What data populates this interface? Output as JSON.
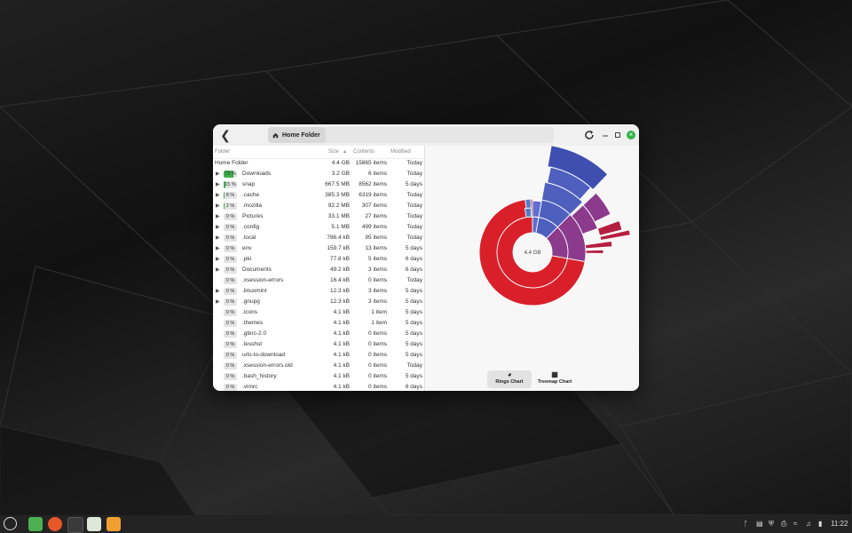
{
  "window": {
    "breadcrumb": "Home Folder",
    "back_icon": "arrow-left-icon",
    "reload_icon": "refresh-icon",
    "minimize_icon": "minimize-icon",
    "maximize_icon": "maximize-icon",
    "close_icon": "close-icon"
  },
  "table": {
    "headers": {
      "folder": "Folder",
      "size": "Size",
      "contents": "Contents",
      "modified": "Modified"
    },
    "root": {
      "name": "Home Folder",
      "size": "4.4 GB",
      "items": "15865 items",
      "modified": "Today"
    },
    "rows": [
      {
        "pct": "73 %",
        "fill": 0.73,
        "name": "Downloads",
        "size": "3.2 GB",
        "items": "6 items",
        "modified": "Today",
        "expandable": true
      },
      {
        "pct": "15 %",
        "fill": 0.15,
        "name": "snap",
        "size": "667.5 MB",
        "items": "8562 items",
        "modified": "5 days",
        "expandable": true
      },
      {
        "pct": "8 %",
        "fill": 0.08,
        "name": ".cache",
        "size": "385.3 MB",
        "items": "6319 items",
        "modified": "Today",
        "expandable": true
      },
      {
        "pct": "2 %",
        "fill": 0.02,
        "name": ".mozilla",
        "size": "92.2 MB",
        "items": "307 items",
        "modified": "Today",
        "expandable": true
      },
      {
        "pct": "0 %",
        "fill": 0,
        "name": "Pictures",
        "size": "33.1 MB",
        "items": "27 items",
        "modified": "Today",
        "expandable": true
      },
      {
        "pct": "0 %",
        "fill": 0,
        "name": ".config",
        "size": "5.1 MB",
        "items": "499 items",
        "modified": "Today",
        "expandable": true
      },
      {
        "pct": "0 %",
        "fill": 0,
        "name": ".local",
        "size": "786.4 kB",
        "items": "95 items",
        "modified": "Today",
        "expandable": true
      },
      {
        "pct": "0 %",
        "fill": 0,
        "name": "env",
        "size": "159.7 kB",
        "items": "13 items",
        "modified": "5 days",
        "expandable": true
      },
      {
        "pct": "0 %",
        "fill": 0,
        "name": ".pki",
        "size": "77.8 kB",
        "items": "5 items",
        "modified": "6 days",
        "expandable": true
      },
      {
        "pct": "0 %",
        "fill": 0,
        "name": "Documents",
        "size": "49.2 kB",
        "items": "3 items",
        "modified": "6 days",
        "expandable": true
      },
      {
        "pct": "0 %",
        "fill": 0,
        "name": ".xsession-errors",
        "size": "16.4 kB",
        "items": "0 items",
        "modified": "Today",
        "expandable": false
      },
      {
        "pct": "0 %",
        "fill": 0,
        "name": ".linuxmint",
        "size": "12.3 kB",
        "items": "3 items",
        "modified": "5 days",
        "expandable": true
      },
      {
        "pct": "0 %",
        "fill": 0,
        "name": ".gnupg",
        "size": "12.3 kB",
        "items": "3 items",
        "modified": "5 days",
        "expandable": true
      },
      {
        "pct": "0 %",
        "fill": 0,
        "name": ".icons",
        "size": "4.1 kB",
        "items": "1 item",
        "modified": "5 days",
        "expandable": false
      },
      {
        "pct": "0 %",
        "fill": 0,
        "name": ".themes",
        "size": "4.1 kB",
        "items": "1 item",
        "modified": "5 days",
        "expandable": false
      },
      {
        "pct": "0 %",
        "fill": 0,
        "name": ".gtkrc-2.0",
        "size": "4.1 kB",
        "items": "0 items",
        "modified": "5 days",
        "expandable": false
      },
      {
        "pct": "0 %",
        "fill": 0,
        "name": ".lesshst",
        "size": "4.1 kB",
        "items": "0 items",
        "modified": "5 days",
        "expandable": false
      },
      {
        "pct": "0 %",
        "fill": 0,
        "name": "urls-to-download",
        "size": "4.1 kB",
        "items": "0 items",
        "modified": "5 days",
        "expandable": false
      },
      {
        "pct": "0 %",
        "fill": 0,
        "name": ".xsession-errors.old",
        "size": "4.1 kB",
        "items": "0 items",
        "modified": "Today",
        "expandable": false
      },
      {
        "pct": "0 %",
        "fill": 0,
        "name": ".bash_history",
        "size": "4.1 kB",
        "items": "0 items",
        "modified": "5 days",
        "expandable": false
      },
      {
        "pct": "0 %",
        "fill": 0,
        "name": ".vimrc",
        "size": "4.1 kB",
        "items": "0 items",
        "modified": "6 days",
        "expandable": false
      }
    ]
  },
  "rings": {
    "center_label": "4.4 GB",
    "colors": {
      "red": "#d9202a",
      "blue": "#4f5fbe",
      "purple": "#8a2f7a",
      "crimson": "#b52040"
    }
  },
  "chart_buttons": {
    "rings": {
      "label": "Rings Chart",
      "icon": "rings-chart-icon",
      "active": true
    },
    "treemap": {
      "label": "Treemap Chart",
      "icon": "treemap-chart-icon",
      "active": false
    }
  },
  "taskbar": {
    "clock": "11:22",
    "apps": [
      "mint-menu-icon",
      "files-icon",
      "firefox-icon",
      "terminal-icon",
      "settings-icon",
      "disk-usage-icon"
    ]
  }
}
